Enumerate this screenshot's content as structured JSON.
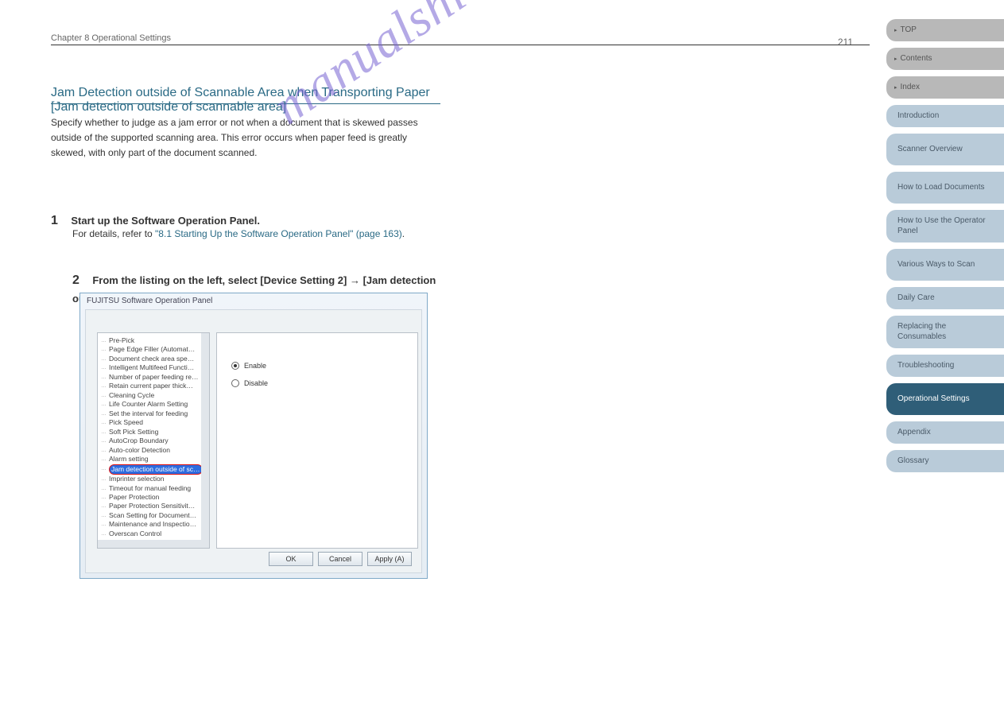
{
  "pageNumber": "211",
  "chapterLine": "Chapter 8 Operational Settings",
  "sectionTitle": "Jam Detection outside of Scannable Area when Transporting Paper [Jam detection outside of scannable area]",
  "para1": "Specify whether to judge as a jam error or not when a document that is skewed passes outside of the supported scanning area. This error occurs when paper feed is greatly skewed, with only part of the document scanned.",
  "step1_label": "1",
  "step1_text": "Start up the Software Operation Panel.",
  "step1_detail_prefix": "For details, refer to ",
  "step1_detail_link": "\"8.1 Starting Up the Software Operation Panel\" (page 163)",
  "step1_detail_suffix": ".",
  "step2_label": "2",
  "step2_text": "From the listing on the left, select [Device Setting 2] → [Jam detection outside of scannable area].",
  "dialog": {
    "title": "FUJITSU Software Operation Panel",
    "tree": [
      "Pre-Pick",
      "Page Edge Filler (Automat…",
      "Document check area spe…",
      "Intelligent Multifeed Functi…",
      "Number of paper feeding re…",
      "Retain current paper thick…",
      "Cleaning Cycle",
      "Life Counter Alarm Setting",
      "Set the interval for feeding",
      "Pick Speed",
      "Soft Pick Setting",
      "AutoCrop Boundary",
      "Auto-color Detection",
      "Alarm setting"
    ],
    "tree_selected": "Jam detection outside of sc…",
    "tree_after": [
      "Imprinter selection",
      "Timeout for manual feeding",
      "Paper Protection",
      "Paper Protection Sensitivit…",
      "Scan Setting for Document…",
      "Maintenance and Inspectio…",
      "Overscan Control"
    ],
    "radio_enable": "Enable",
    "radio_disable": "Disable",
    "btn_ok": "OK",
    "btn_cancel": "Cancel",
    "btn_apply": "Apply (A)"
  },
  "watermark": "manualshive.com",
  "sidebar": {
    "gray": [
      "TOP",
      "Contents",
      "Index"
    ],
    "tabs": [
      "Introduction",
      "Scanner Overview",
      "How to Load Documents",
      "How to Use the Operator Panel",
      "Various Ways to Scan",
      "Daily Care",
      "Replacing the Consumables",
      "Troubleshooting",
      "Operational Settings",
      "Appendix",
      "Glossary"
    ],
    "activeIndex": 8
  }
}
